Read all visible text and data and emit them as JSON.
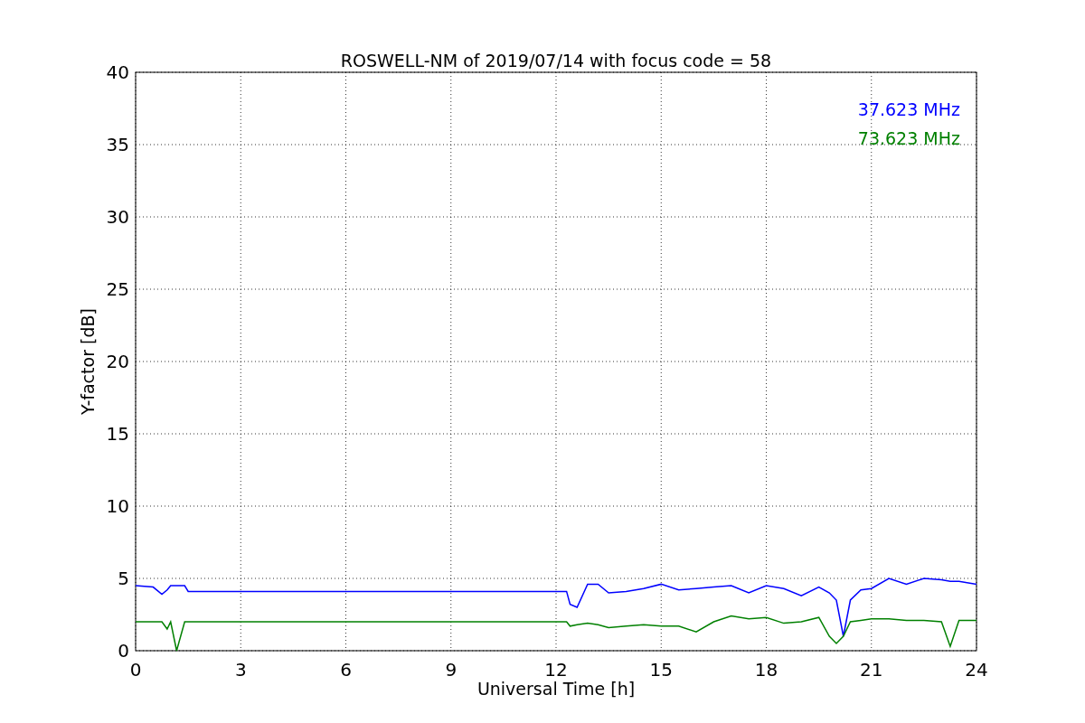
{
  "chart_data": {
    "type": "line",
    "title": "ROSWELL-NM of 2019/07/14 with focus code = 58",
    "xlabel": "Universal Time [h]",
    "ylabel": "Y-factor [dB]",
    "x": [
      0,
      0.5,
      0.75,
      0.9,
      1,
      1.17,
      1.4,
      1.5,
      12.3,
      12.4,
      12.6,
      12.9,
      13.2,
      13.5,
      14,
      14.5,
      15,
      15.5,
      16,
      16.5,
      17,
      17.5,
      18,
      18.5,
      19,
      19.5,
      19.8,
      20,
      20.2,
      20.4,
      20.7,
      21,
      21.5,
      22,
      22.5,
      23,
      23.25,
      23.5,
      24
    ],
    "series": [
      {
        "name": "37.623 MHz",
        "color": "#0000ff",
        "values": [
          4.5,
          4.4,
          3.9,
          4.2,
          4.5,
          4.5,
          4.5,
          4.1,
          4.1,
          3.2,
          3.0,
          4.6,
          4.6,
          4.0,
          4.1,
          4.3,
          4.6,
          4.2,
          4.3,
          4.4,
          4.5,
          4.0,
          4.5,
          4.3,
          3.8,
          4.4,
          4.0,
          3.5,
          1.0,
          3.5,
          4.2,
          4.3,
          5.0,
          4.6,
          5.0,
          4.9,
          4.8,
          4.8,
          4.6
        ]
      },
      {
        "name": "73.623 MHz",
        "color": "#008000",
        "values": [
          2.0,
          2.0,
          2.0,
          1.5,
          2.0,
          0,
          2.0,
          2.0,
          2.0,
          1.7,
          1.8,
          1.9,
          1.8,
          1.6,
          1.7,
          1.8,
          1.7,
          1.7,
          1.3,
          2.0,
          2.4,
          2.2,
          2.3,
          1.9,
          2.0,
          2.3,
          1.0,
          0.5,
          1.0,
          2.0,
          2.1,
          2.2,
          2.2,
          2.1,
          2.1,
          2.0,
          0.3,
          2.1,
          2.1
        ]
      }
    ],
    "xlim": [
      0,
      24
    ],
    "ylim": [
      0,
      40
    ],
    "xticks": [
      0,
      3,
      6,
      9,
      12,
      15,
      18,
      21,
      24
    ],
    "yticks": [
      0,
      5,
      10,
      15,
      20,
      25,
      30,
      35,
      40
    ],
    "grid": true
  }
}
